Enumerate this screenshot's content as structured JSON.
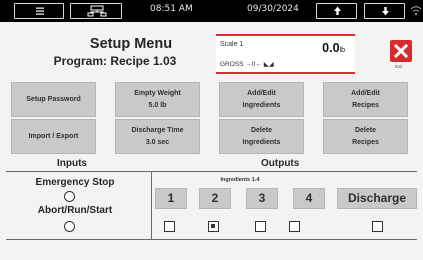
{
  "status_bar": {
    "menu_icon": "hamburger-icon",
    "network_icon": "network-icon",
    "time": "08:51 AM",
    "date": "09/30/2024",
    "up_icon": "arrow-up-icon",
    "down_icon": "arrow-down-icon",
    "wifi_icon": "wifi-icon"
  },
  "header": {
    "title": "Setup Menu",
    "subtitle": "Program: Recipe 1.03"
  },
  "scale": {
    "name": "Scale 1",
    "value": "0.0",
    "unit": "lb",
    "status": "GROSS →0← ◣◢",
    "accent_color": "#d63035"
  },
  "exit": {
    "label": "Exit",
    "icon": "close-icon",
    "color": "#d72b30"
  },
  "buttons": {
    "setup_password": "Setup Password",
    "empty_weight_label": "Empty Weight",
    "empty_weight_value": "5.0 lb",
    "add_edit_ingredients_1": "Add/Edit",
    "add_edit_ingredients_2": "Ingredients",
    "add_edit_recipes_1": "Add/Edit",
    "add_edit_recipes_2": "Recipes",
    "import_export": "Import / Export",
    "discharge_time_label": "Discharge Time",
    "discharge_time_value": "3.0 sec",
    "delete_ingredients_1": "Delete",
    "delete_ingredients_2": "Ingredients",
    "delete_recipes_1": "Delete",
    "delete_recipes_2": "Recipes"
  },
  "inputs": {
    "heading": "Inputs",
    "items": [
      {
        "label": "Emergency Stop",
        "active": false
      },
      {
        "label": "Abort/Run/Start",
        "active": false
      }
    ]
  },
  "outputs": {
    "heading": "Outputs",
    "group_label": "Ingredients 1-4",
    "items": [
      {
        "label": "1",
        "checked": false
      },
      {
        "label": "2",
        "checked": true
      },
      {
        "label": "3",
        "checked": false
      },
      {
        "label": "4",
        "checked": false
      },
      {
        "label": "Discharge",
        "checked": false
      }
    ]
  }
}
